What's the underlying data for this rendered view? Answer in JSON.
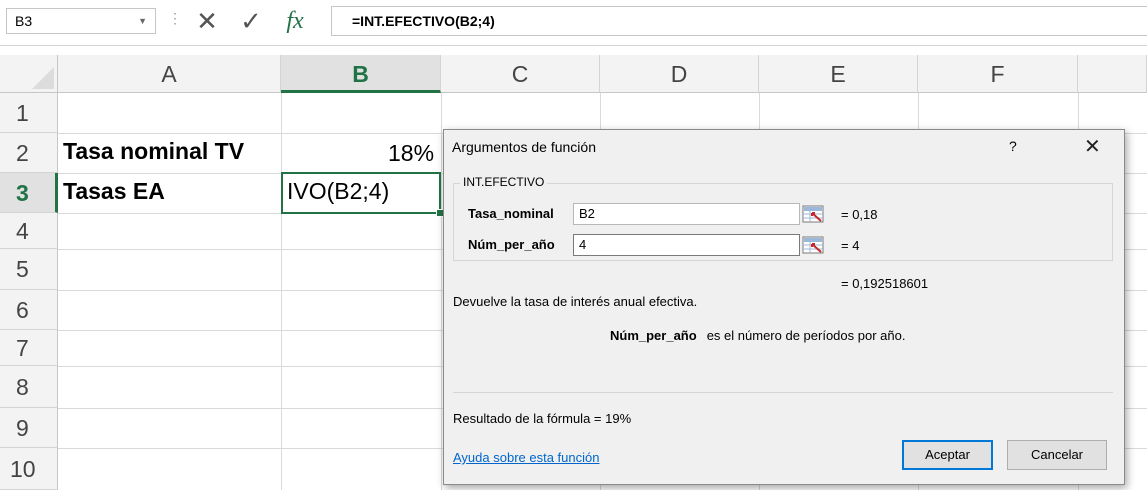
{
  "formula_bar": {
    "name_box": "B3",
    "cancel_icon": "✕",
    "enter_icon": "✓",
    "fx_label": "fx",
    "formula": "=INT.EFECTIVO(B2;4)"
  },
  "sheet": {
    "columns": [
      "A",
      "B",
      "C",
      "D",
      "E",
      "F"
    ],
    "selected_column": "B",
    "rows": [
      "1",
      "2",
      "3",
      "4",
      "5",
      "6",
      "7",
      "8",
      "9",
      "10"
    ],
    "selected_row": "3",
    "cells": {
      "A2": "Tasa nominal TV",
      "B2": "18%",
      "A3": "Tasas EA",
      "B3": "IVO(B2;4)"
    }
  },
  "dialog": {
    "title": "Argumentos de función",
    "help": "?",
    "close": "✕",
    "function_name": "INT.EFECTIVO",
    "args": [
      {
        "label": "Tasa_nominal",
        "value": "B2",
        "result": "=  0,18"
      },
      {
        "label": "Núm_per_año",
        "value": "4",
        "result": "=  4"
      }
    ],
    "function_result": "=  0,192518601",
    "description": "Devuelve la tasa de interés anual efectiva.",
    "arg_description_name": "Núm_per_año",
    "arg_description_text": "es el número de períodos por año.",
    "formula_result": "Resultado de la fórmula =   19%",
    "help_link": "Ayuda sobre esta función",
    "ok_label": "Aceptar",
    "cancel_label": "Cancelar"
  },
  "colors": {
    "excel_green": "#217346",
    "link_blue": "#0066cc",
    "default_button_border": "#0078d7"
  }
}
